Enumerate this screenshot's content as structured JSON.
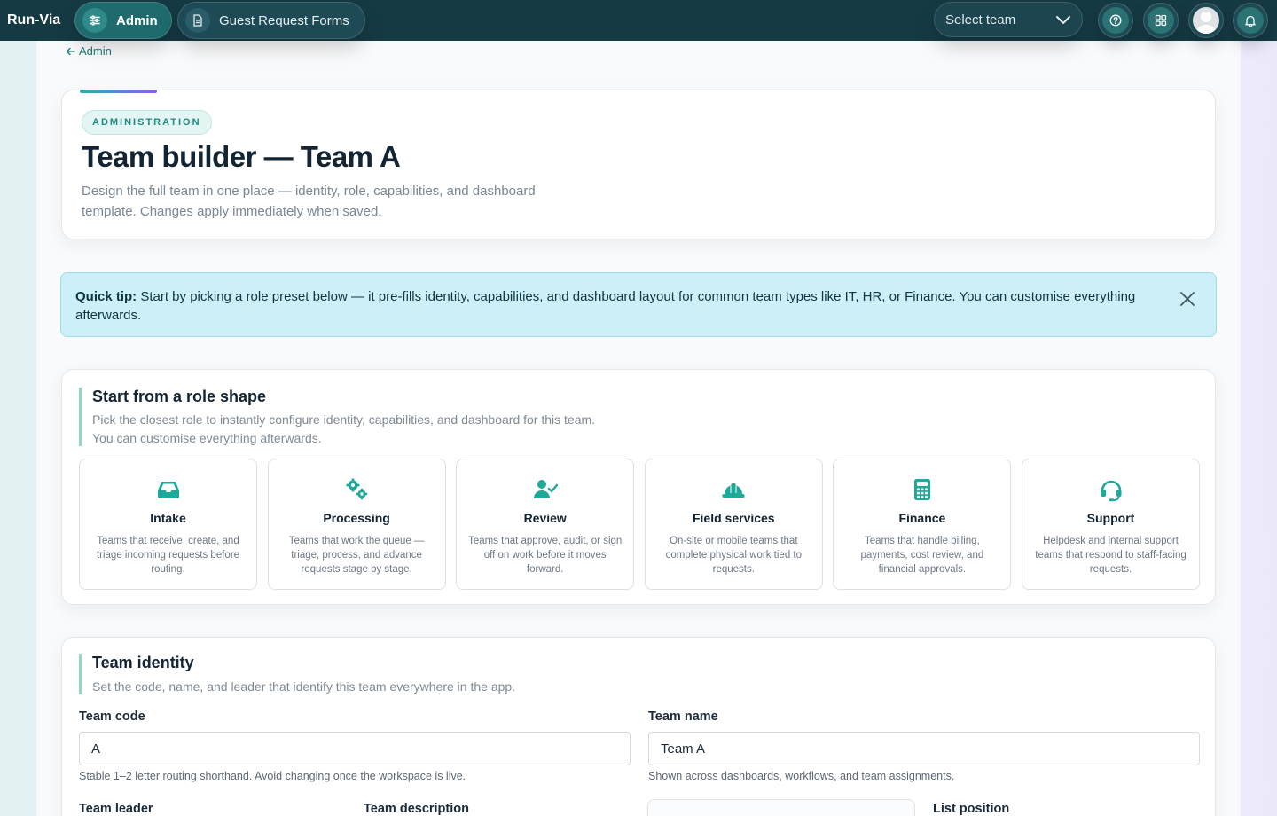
{
  "app": {
    "brand": "Run-Via"
  },
  "nav": {
    "admin_label": "Admin",
    "guest_forms_label": "Guest Request Forms",
    "team_select_placeholder": "Select team"
  },
  "breadcrumb": {
    "back_label": "Admin"
  },
  "hero": {
    "badge": "ADMINISTRATION",
    "title": "Team builder — Team A",
    "subtitle": "Design the full team in one place — identity, role, capabilities, and dashboard template. Changes apply immediately when saved."
  },
  "tip": {
    "lead": "Quick tip:",
    "text": " Start by picking a role preset below — it pre-fills identity, capabilities, and dashboard layout for common team types like IT, HR, or Finance. You can customise everything afterwards."
  },
  "roles_section": {
    "title": "Start from a role shape",
    "subtitle": "Pick the closest role to instantly configure identity, capabilities, and dashboard for this team. You can customise everything afterwards.",
    "roles": [
      {
        "name": "Intake",
        "icon": "inbox-icon",
        "description": "Teams that receive, create, and triage incoming requests before routing."
      },
      {
        "name": "Processing",
        "icon": "gears-icon",
        "description": "Teams that work the queue — triage, process, and advance requests stage by stage."
      },
      {
        "name": "Review",
        "icon": "user-check-icon",
        "description": "Teams that approve, audit, or sign off on work before it moves forward."
      },
      {
        "name": "Field services",
        "icon": "hard-hat-icon",
        "description": "On-site or mobile teams that complete physical work tied to requests."
      },
      {
        "name": "Finance",
        "icon": "calculator-icon",
        "description": "Teams that handle billing, payments, cost review, and financial approvals."
      },
      {
        "name": "Support",
        "icon": "headset-icon",
        "description": "Helpdesk and internal support teams that respond to staff-facing requests."
      }
    ]
  },
  "identity_section": {
    "title": "Team identity",
    "subtitle": "Set the code, name, and leader that identify this team everywhere in the app.",
    "team_code": {
      "label": "Team code",
      "value": "A",
      "help": "Stable 1–2 letter routing shorthand. Avoid changing once the workspace is live."
    },
    "team_name": {
      "label": "Team name",
      "value": "Team A",
      "help": "Shown across dashboards, workflows, and team assignments."
    },
    "team_leader_label": "Team leader",
    "team_description_label": "Team description",
    "list_position_label": "List position"
  },
  "colors": {
    "topbar": "#163a44",
    "accent": "#1fa99a",
    "tip_bg": "#cdeff8"
  }
}
